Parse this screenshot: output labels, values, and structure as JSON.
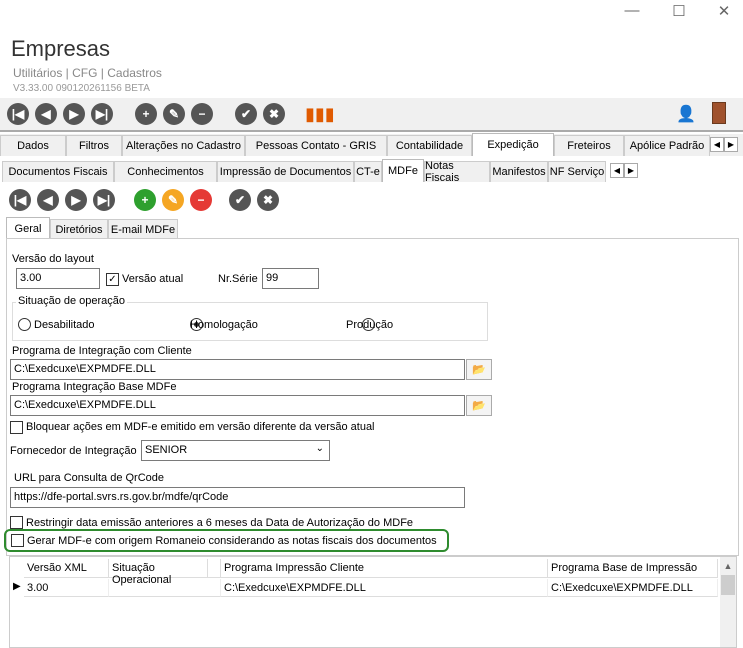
{
  "window": {
    "minimize": "—",
    "maximize": "☐",
    "close": "✕"
  },
  "header": {
    "title": "Empresas",
    "breadcrumb": "Utilitários | CFG | Cadastros",
    "version": "V3.33.00 090120261156 BETA"
  },
  "main_tabs": [
    "Dados",
    "Filtros",
    "Alterações no Cadastro",
    "Pessoas Contato - GRIS",
    "Contabilidade",
    "Expedição",
    "Freteiros",
    "Apólice Padrão"
  ],
  "sub_tabs": [
    "Documentos Fiscais",
    "Conhecimentos",
    "Impressão de Documentos",
    "CT-e",
    "MDFe",
    "Notas Fiscais",
    "Manifestos",
    "NF Serviço"
  ],
  "inner_tabs": [
    "Geral",
    "Diretórios",
    "E-mail MDFe"
  ],
  "form": {
    "versao_layout_label": "Versão do layout",
    "versao_layout": "3.00",
    "versao_atual_label": "Versão atual",
    "versao_atual_checked": true,
    "nr_serie_label": "Nr.Série",
    "nr_serie": "99",
    "situacao_label": "Situação de operação",
    "situacao_options": [
      "Desabilitado",
      "Homologação",
      "Produção"
    ],
    "situacao_selected": "Homologação",
    "prog_cliente_label": "Programa de Integração com Cliente",
    "prog_cliente": "C:\\Exedcuxe\\EXPMDFE.DLL",
    "prog_base_label": "Programa Integração Base MDFe",
    "prog_base": "C:\\Exedcuxe\\EXPMDFE.DLL",
    "bloquear_label": "Bloquear ações em MDF-e emitido em versão diferente da versão atual",
    "fornecedor_label": "Fornecedor de Integração",
    "fornecedor": "SENIOR",
    "url_label": "URL para Consulta de QrCode",
    "url": "https://dfe-portal.svrs.rs.gov.br/mdfe/qrCode",
    "restringir_label": "Restringir data emissão anteriores a 6 meses da Data de Autorização do MDFe",
    "gerar_label": "Gerar MDF-e com origem Romaneio considerando as notas fiscais dos documentos"
  },
  "grid": {
    "columns": [
      "Versão XML",
      "Situação Operacional",
      "Programa Impressão Cliente",
      "Programa Base de Impressão"
    ],
    "rows": [
      [
        "3.00",
        "",
        "C:\\Exedcuxe\\EXPMDFE.DLL",
        "C:\\Exedcuxe\\EXPMDFE.DLL"
      ]
    ]
  },
  "colors": {
    "highlight": "#2e8b2e",
    "add": "#2ea02e",
    "edit": "#f5a623",
    "delete": "#e53935"
  }
}
